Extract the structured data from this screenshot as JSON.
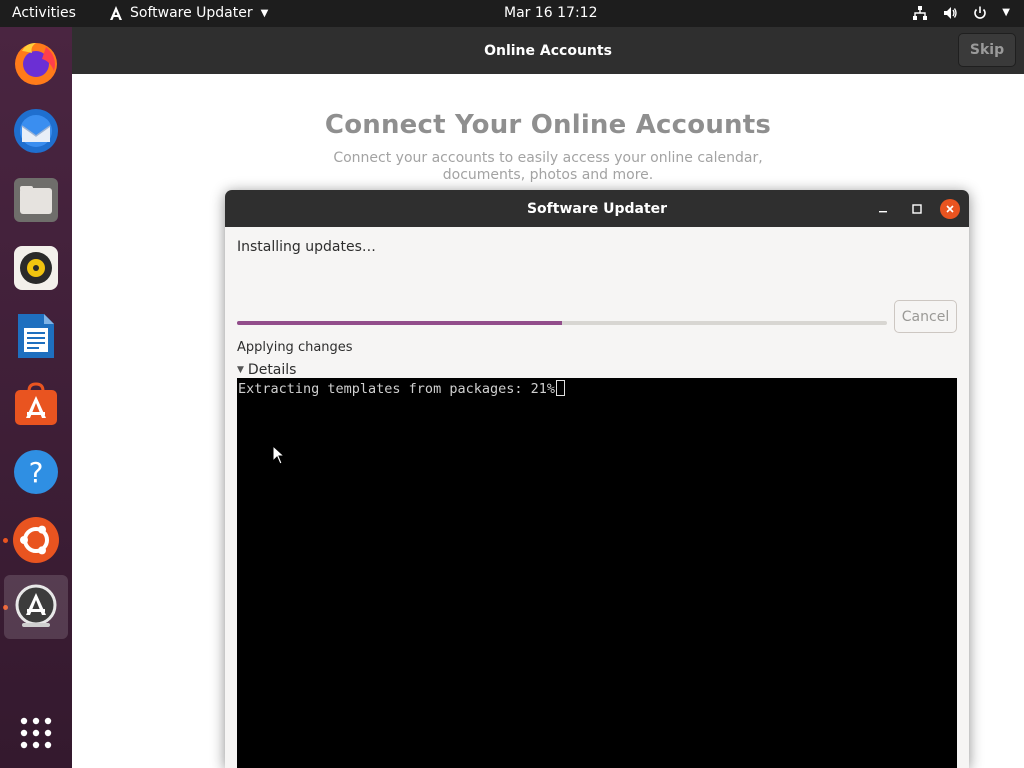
{
  "topbar": {
    "activities": "Activities",
    "app_name": "Software Updater",
    "clock": "Mar 16  17:12",
    "icons": [
      "network-icon",
      "volume-icon",
      "power-icon",
      "chevron-down-icon"
    ]
  },
  "dock": {
    "items": [
      {
        "name": "firefox",
        "icon": "firefox-icon",
        "running": false
      },
      {
        "name": "thunderbird",
        "icon": "thunderbird-icon",
        "running": false
      },
      {
        "name": "files",
        "icon": "files-icon",
        "running": false
      },
      {
        "name": "rhythmbox",
        "icon": "rhythmbox-icon",
        "running": false
      },
      {
        "name": "libreoffice-writer",
        "icon": "writer-icon",
        "running": false
      },
      {
        "name": "ubuntu-software",
        "icon": "software-icon",
        "running": false
      },
      {
        "name": "help",
        "icon": "help-icon",
        "running": false
      },
      {
        "name": "ubuntu-initial-setup",
        "icon": "ubuntu-icon",
        "running": true
      },
      {
        "name": "software-updater",
        "icon": "updater-icon",
        "running": true,
        "active": true
      }
    ],
    "apps_grid_icon": "show-apps-icon"
  },
  "online_accounts": {
    "window_title": "Online Accounts",
    "skip_label": "Skip",
    "heading": "Connect Your Online Accounts",
    "description": "Connect your accounts to easily access your online calendar, documents, photos and more."
  },
  "updater": {
    "window_title": "Software Updater",
    "status": "Installing updates…",
    "progress_fraction": 0.5,
    "cancel_label": "Cancel",
    "phase": "Applying changes",
    "details_label": "Details",
    "terminal_text": "Extracting templates from packages: 21%"
  },
  "colors": {
    "accent_orange": "#e95420",
    "progress_purple": "#924d8b",
    "dock_purple": "#3a1f33"
  }
}
